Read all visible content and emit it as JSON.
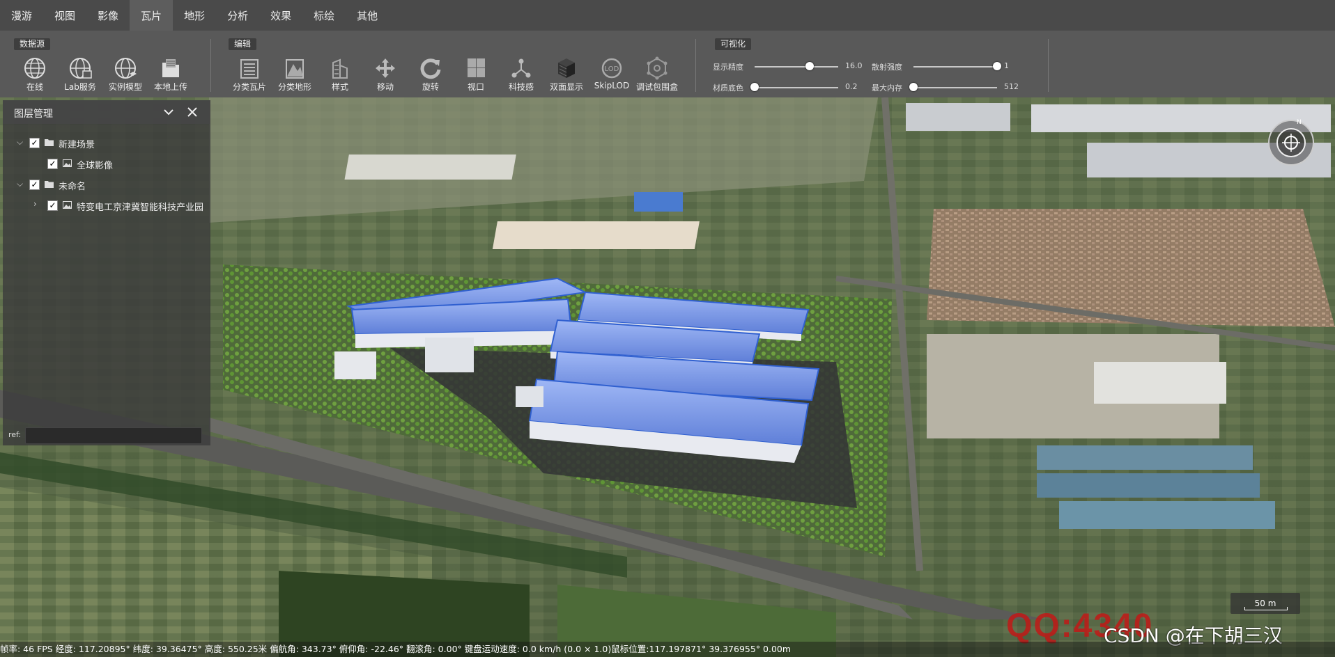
{
  "menu": {
    "tabs": [
      "漫游",
      "视图",
      "影像",
      "瓦片",
      "地形",
      "分析",
      "效果",
      "标绘",
      "其他"
    ],
    "active": "瓦片"
  },
  "ribbon": {
    "datasource": {
      "title": "数据源",
      "tools": [
        {
          "label": "在线",
          "icon": "globe-icon"
        },
        {
          "label": "Lab服务",
          "icon": "globe-grid-icon"
        },
        {
          "label": "实例模型",
          "icon": "globe-model-icon"
        },
        {
          "label": "本地上传",
          "icon": "folder-upload-icon"
        }
      ]
    },
    "edit": {
      "title": "编辑",
      "tools": [
        {
          "label": "分类瓦片",
          "icon": "classify-tile-icon"
        },
        {
          "label": "分类地形",
          "icon": "classify-terrain-icon"
        },
        {
          "label": "样式",
          "icon": "style-icon"
        },
        {
          "label": "移动",
          "icon": "move-icon"
        },
        {
          "label": "旋转",
          "icon": "rotate-icon"
        },
        {
          "label": "视口",
          "icon": "viewport-icon"
        },
        {
          "label": "科技感",
          "icon": "tech-icon"
        },
        {
          "label": "双面显示",
          "icon": "double-side-icon"
        },
        {
          "label": "SkipLOD",
          "icon": "lod-icon"
        },
        {
          "label": "调试包围盒",
          "icon": "bounding-box-icon"
        }
      ]
    },
    "visual": {
      "title": "可视化",
      "sliders": [
        {
          "label": "显示精度",
          "value": "16.0",
          "fraction": 0.66
        },
        {
          "label": "散射强度",
          "value": "1",
          "fraction": 1.0
        },
        {
          "label": "材质底色",
          "value": "0.2",
          "fraction": 0.0
        },
        {
          "label": "最大内存",
          "value": "512",
          "fraction": 0.0
        }
      ]
    }
  },
  "layers": {
    "title": "图层管理",
    "items": [
      {
        "label": "新建场景",
        "level": 0,
        "expanded": true,
        "checked": true,
        "icon": "folder-icon"
      },
      {
        "label": "全球影像",
        "level": 1,
        "expanded": null,
        "checked": true,
        "icon": "image-icon"
      },
      {
        "label": "未命名",
        "level": 0,
        "expanded": true,
        "checked": true,
        "icon": "folder-icon"
      },
      {
        "label": "特变电工京津冀智能科技产业园",
        "level": 1,
        "expanded": false,
        "checked": true,
        "icon": "image-icon"
      }
    ],
    "ref_label": "ref:",
    "ref_value": ""
  },
  "overlay": {
    "compass_north": "N",
    "scale_label": "50 m",
    "status": "帧率: 46 FPS 经度: 117.20895° 纬度: 39.36475° 高度: 550.25米 偏航角: 343.73° 俯仰角: -22.46° 翻滚角: 0.00° 键盘运动速度: 0.0 km/h (0.0 × 1.0)鼠标位置:117.197871° 39.376955° 0.00m",
    "watermark_qq": "QQ:4340",
    "watermark_csdn": "CSDN @在下胡三汉"
  },
  "colors": {
    "menubar": "#4a4a4a",
    "ribbon": "#595959",
    "roof_blue": "#6f8fe0",
    "watermark_red": "#c81414"
  }
}
